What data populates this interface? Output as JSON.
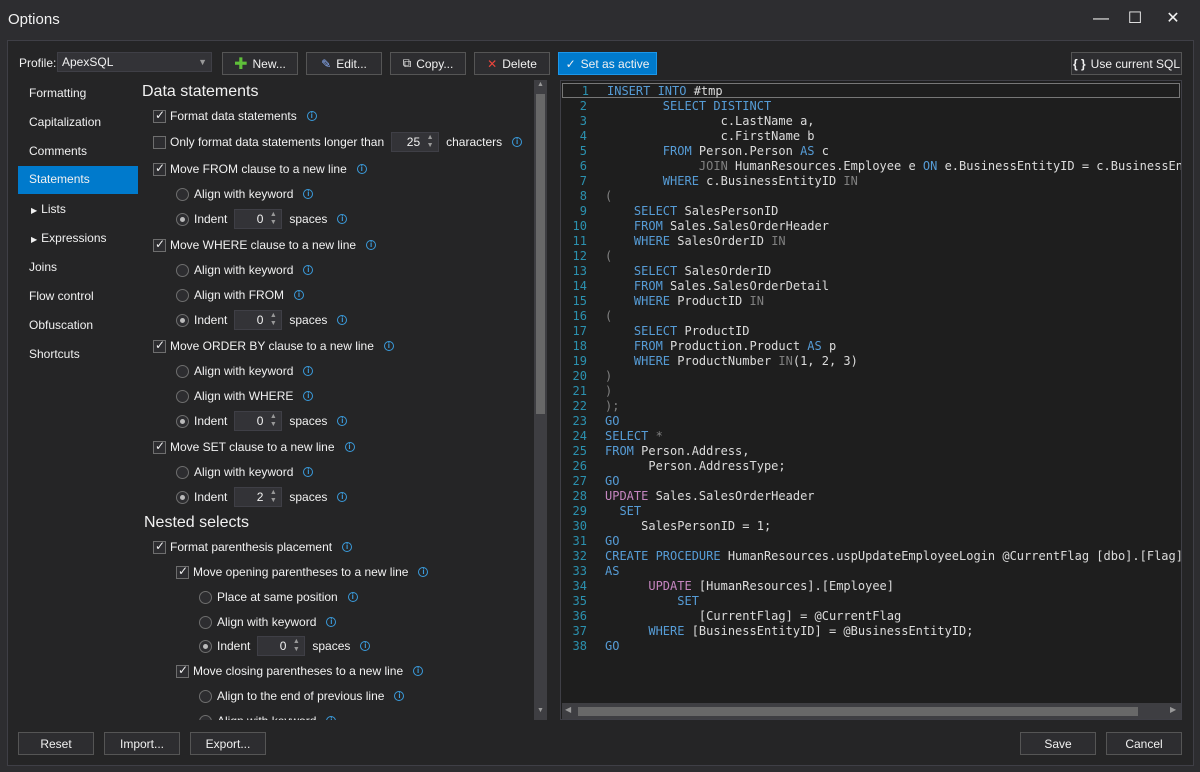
{
  "window": {
    "title": "Options",
    "minimize": "—",
    "maximize": "☐",
    "close": "✕"
  },
  "profile": {
    "label": "Profile:",
    "value": "ApexSQL"
  },
  "toolbar": {
    "new": "New...",
    "edit": "Edit...",
    "copy": "Copy...",
    "delete": "Delete",
    "set_active": "Set as active",
    "use_current": "Use current SQL",
    "use_current_icon": "{ }"
  },
  "nav": [
    "Formatting",
    "Capitalization",
    "Comments",
    "Statements",
    "Lists",
    "Expressions",
    "Joins",
    "Flow control",
    "Obfuscation",
    "Shortcuts"
  ],
  "settings": {
    "section1": "Data statements",
    "format_data": "Format data statements",
    "only_format": "Only format data statements longer than",
    "only_format_value": "25",
    "characters": "characters",
    "move_from": "Move FROM clause to a new line",
    "align_keyword": "Align with keyword",
    "indent": "Indent",
    "spaces": "spaces",
    "indent_from": "0",
    "move_where": "Move WHERE clause to a new line",
    "align_from": "Align with FROM",
    "indent_where": "0",
    "move_order": "Move ORDER BY clause to a new line",
    "align_where": "Align with WHERE",
    "indent_order": "0",
    "move_set": "Move SET clause to a new line",
    "indent_set": "2",
    "section2": "Nested selects",
    "format_paren": "Format parenthesis placement",
    "move_opening": "Move opening parentheses to a new line",
    "same_position": "Place at same position",
    "indent_open": "0",
    "move_closing": "Move closing parentheses to a new line",
    "align_end_prev": "Align to the end of previous line"
  },
  "code": [
    [
      [
        "INSERT INTO",
        "kw"
      ],
      [
        " #tmp",
        "tx"
      ]
    ],
    [
      [
        "        SELECT DISTINCT",
        "kw"
      ]
    ],
    [
      [
        "                c.LastName a,",
        "tx"
      ]
    ],
    [
      [
        "                c.FirstName b",
        "tx"
      ]
    ],
    [
      [
        "        FROM",
        "kw"
      ],
      [
        " Person.Person ",
        "tx"
      ],
      [
        "AS",
        "kw"
      ],
      [
        " c",
        "tx"
      ]
    ],
    [
      [
        "             JOIN",
        "op"
      ],
      [
        " HumanResources.Employee e ",
        "tx"
      ],
      [
        "ON",
        "kw"
      ],
      [
        " e.BusinessEntityID = c.BusinessEntit",
        "tx"
      ]
    ],
    [
      [
        "        WHERE",
        "kw"
      ],
      [
        " c.BusinessEntityID ",
        "tx"
      ],
      [
        "IN",
        "op"
      ]
    ],
    [
      [
        "(",
        "op"
      ]
    ],
    [
      [
        "    SELECT",
        "kw"
      ],
      [
        " SalesPersonID",
        "tx"
      ]
    ],
    [
      [
        "    FROM",
        "kw"
      ],
      [
        " Sales.SalesOrderHeader",
        "tx"
      ]
    ],
    [
      [
        "    WHERE",
        "kw"
      ],
      [
        " SalesOrderID ",
        "tx"
      ],
      [
        "IN",
        "op"
      ]
    ],
    [
      [
        "(",
        "op"
      ]
    ],
    [
      [
        "    SELECT",
        "kw"
      ],
      [
        " SalesOrderID",
        "tx"
      ]
    ],
    [
      [
        "    FROM",
        "kw"
      ],
      [
        " Sales.SalesOrderDetail",
        "tx"
      ]
    ],
    [
      [
        "    WHERE",
        "kw"
      ],
      [
        " ProductID ",
        "tx"
      ],
      [
        "IN",
        "op"
      ]
    ],
    [
      [
        "(",
        "op"
      ]
    ],
    [
      [
        "    SELECT",
        "kw"
      ],
      [
        " ProductID",
        "tx"
      ]
    ],
    [
      [
        "    FROM",
        "kw"
      ],
      [
        " Production.Product ",
        "tx"
      ],
      [
        "AS",
        "kw"
      ],
      [
        " p",
        "tx"
      ]
    ],
    [
      [
        "    WHERE",
        "kw"
      ],
      [
        " ProductNumber ",
        "tx"
      ],
      [
        "IN",
        "op"
      ],
      [
        "(1, 2, 3)",
        "tx"
      ]
    ],
    [
      [
        ")",
        "op"
      ]
    ],
    [
      [
        ")",
        "op"
      ]
    ],
    [
      [
        ");",
        "op"
      ]
    ],
    [
      [
        "GO",
        "kw"
      ]
    ],
    [
      [
        "SELECT",
        "kw"
      ],
      [
        " *",
        "op"
      ]
    ],
    [
      [
        "FROM",
        "kw"
      ],
      [
        " Person.Address,",
        "tx"
      ]
    ],
    [
      [
        "      Person.AddressType;",
        "tx"
      ]
    ],
    [
      [
        "GO",
        "kw"
      ]
    ],
    [
      [
        "UPDATE",
        "pk"
      ],
      [
        " Sales.SalesOrderHeader",
        "tx"
      ]
    ],
    [
      [
        "  SET",
        "kw"
      ]
    ],
    [
      [
        "     SalesPersonID = 1;",
        "tx"
      ]
    ],
    [
      [
        "GO",
        "kw"
      ]
    ],
    [
      [
        "CREATE PROCEDURE",
        "kw"
      ],
      [
        " HumanResources.uspUpdateEmployeeLogin @CurrentFlag [dbo].[Flag]",
        "tx"
      ]
    ],
    [
      [
        "AS",
        "kw"
      ]
    ],
    [
      [
        "      UPDATE",
        "pk"
      ],
      [
        " [HumanResources].[Employee]",
        "tx"
      ]
    ],
    [
      [
        "          SET",
        "kw"
      ]
    ],
    [
      [
        "             [CurrentFlag] = @CurrentFlag",
        "tx"
      ]
    ],
    [
      [
        "      WHERE",
        "kw"
      ],
      [
        " [BusinessEntityID] = @BusinessEntityID;",
        "tx"
      ]
    ],
    [
      [
        "GO",
        "kw"
      ]
    ]
  ],
  "footer": {
    "reset": "Reset",
    "import": "Import...",
    "export": "Export...",
    "save": "Save",
    "cancel": "Cancel"
  }
}
